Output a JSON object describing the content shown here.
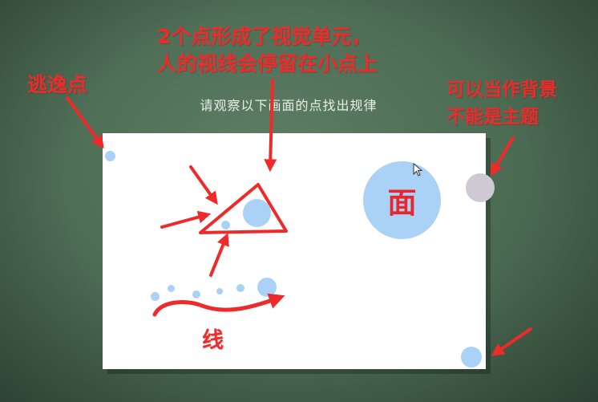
{
  "slide": {
    "title": "请观察以下画面的点找出规律"
  },
  "annotations": {
    "escape_point": "逃逸点",
    "top_line1": "2个点形成了视觉单元，",
    "top_line2": "人的视线会停留在小点上",
    "right_line1": "可以当作背景",
    "right_line2": "不能是主题",
    "line_label": "线",
    "surface_label": "面"
  },
  "colors": {
    "annotation_red": "#ee2a2a",
    "dot_blue": "#a9d2f6",
    "chalkboard_green": "#4b6a52"
  }
}
